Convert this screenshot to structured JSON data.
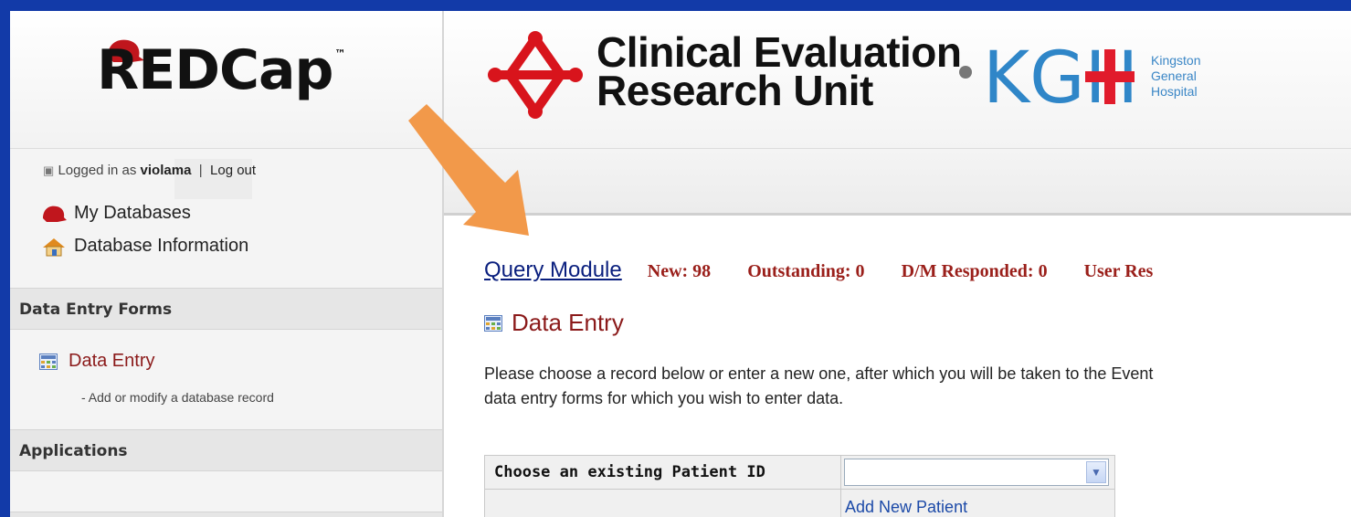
{
  "sidebar": {
    "logo_text": "REDCap",
    "logo_tm": "™",
    "login_prefix": "Logged in as",
    "username": "violama",
    "separator": "|",
    "logout_label": "Log out",
    "nav": [
      {
        "label": "My Databases"
      },
      {
        "label": "Database Information"
      }
    ],
    "section_data_entry_forms": "Data Entry Forms",
    "data_entry_link": "Data Entry",
    "data_entry_desc": "- Add or modify a database record",
    "section_applications": "Applications"
  },
  "header": {
    "org_line1": "Clinical Evaluation",
    "org_line2": "Research Unit",
    "kgh_letters": "KGH",
    "kgh_line1": "Kingston",
    "kgh_line2": "General",
    "kgh_line3": "Hospital"
  },
  "main": {
    "query_module_label": "Query Module",
    "stats": [
      "New: 98",
      "Outstanding: 0",
      "D/M Responded: 0",
      "User Res"
    ],
    "section_title": "Data Entry",
    "description_line1": "Please choose a record below or enter a new one, after which you will be taken to the Event",
    "description_line2": "data entry forms for which you wish to enter data.",
    "choose_label": "Choose an existing Patient ID",
    "select_value": "",
    "add_new_label": "Add New Patient"
  },
  "colors": {
    "border_blue": "#123aa8",
    "accent_red": "#8b1a1a",
    "arrow_orange": "#f2994a",
    "link_blue": "#0a1f7e"
  }
}
